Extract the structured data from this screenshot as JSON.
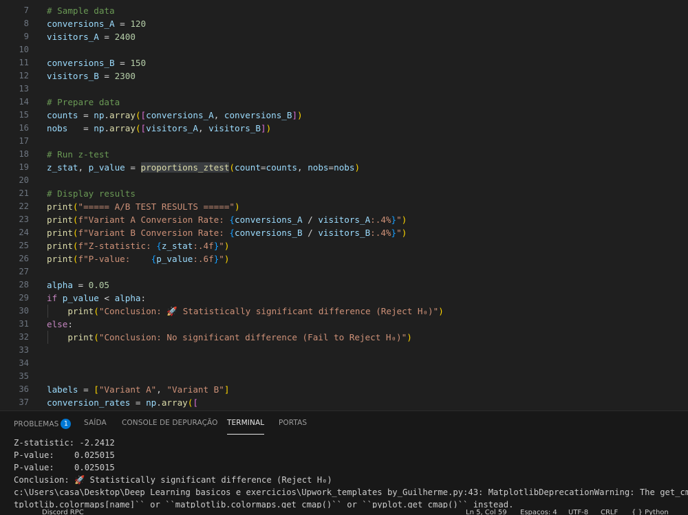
{
  "editor": {
    "lines": [
      {
        "n": "7",
        "tokens": [
          [
            "t-cm",
            "# Sample data"
          ]
        ]
      },
      {
        "n": "8",
        "tokens": [
          [
            "t-var",
            "conversions_A"
          ],
          [
            "t-op",
            " = "
          ],
          [
            "t-num",
            "120"
          ]
        ]
      },
      {
        "n": "9",
        "tokens": [
          [
            "t-var",
            "visitors_A"
          ],
          [
            "t-op",
            " = "
          ],
          [
            "t-num",
            "2400"
          ]
        ]
      },
      {
        "n": "10",
        "tokens": []
      },
      {
        "n": "11",
        "tokens": [
          [
            "t-var",
            "conversions_B"
          ],
          [
            "t-op",
            " = "
          ],
          [
            "t-num",
            "150"
          ]
        ]
      },
      {
        "n": "12",
        "tokens": [
          [
            "t-var",
            "visitors_B"
          ],
          [
            "t-op",
            " = "
          ],
          [
            "t-num",
            "2300"
          ]
        ]
      },
      {
        "n": "13",
        "tokens": []
      },
      {
        "n": "14",
        "tokens": [
          [
            "t-cm",
            "# Prepare data"
          ]
        ]
      },
      {
        "n": "15",
        "tokens": [
          [
            "t-var",
            "counts"
          ],
          [
            "t-op",
            " = "
          ],
          [
            "t-var",
            "np"
          ],
          [
            "t-op",
            "."
          ],
          [
            "t-fn",
            "array"
          ],
          [
            "t-b1",
            "("
          ],
          [
            "t-b2",
            "["
          ],
          [
            "t-var",
            "conversions_A"
          ],
          [
            "t-op",
            ", "
          ],
          [
            "t-var",
            "conversions_B"
          ],
          [
            "t-b2",
            "]"
          ],
          [
            "t-b1",
            ")"
          ]
        ]
      },
      {
        "n": "16",
        "tokens": [
          [
            "t-var",
            "nobs"
          ],
          [
            "t-op",
            "   = "
          ],
          [
            "t-var",
            "np"
          ],
          [
            "t-op",
            "."
          ],
          [
            "t-fn",
            "array"
          ],
          [
            "t-b1",
            "("
          ],
          [
            "t-b2",
            "["
          ],
          [
            "t-var",
            "visitors_A"
          ],
          [
            "t-op",
            ", "
          ],
          [
            "t-var",
            "visitors_B"
          ],
          [
            "t-b2",
            "]"
          ],
          [
            "t-b1",
            ")"
          ]
        ]
      },
      {
        "n": "17",
        "tokens": []
      },
      {
        "n": "18",
        "tokens": [
          [
            "t-cm",
            "# Run z-test"
          ]
        ]
      },
      {
        "n": "19",
        "tokens": [
          [
            "t-var",
            "z_stat"
          ],
          [
            "t-op",
            ", "
          ],
          [
            "t-var",
            "p_value"
          ],
          [
            "t-op",
            " = "
          ],
          [
            "t-fn t-hl",
            "proportions_ztest"
          ],
          [
            "t-b1",
            "("
          ],
          [
            "t-var",
            "count"
          ],
          [
            "t-op",
            "="
          ],
          [
            "t-var",
            "counts"
          ],
          [
            "t-op",
            ", "
          ],
          [
            "t-var",
            "nobs"
          ],
          [
            "t-op",
            "="
          ],
          [
            "t-var",
            "nobs"
          ],
          [
            "t-b1",
            ")"
          ]
        ]
      },
      {
        "n": "20",
        "tokens": []
      },
      {
        "n": "21",
        "tokens": [
          [
            "t-cm",
            "# Display results"
          ]
        ]
      },
      {
        "n": "22",
        "tokens": [
          [
            "t-fn",
            "print"
          ],
          [
            "t-b1",
            "("
          ],
          [
            "t-str",
            "\"===== A/B TEST RESULTS =====\""
          ],
          [
            "t-b1",
            ")"
          ]
        ]
      },
      {
        "n": "23",
        "tokens": [
          [
            "t-fn",
            "print"
          ],
          [
            "t-b1",
            "("
          ],
          [
            "t-str",
            "f\"Variant A Conversion Rate: "
          ],
          [
            "t-b3",
            "{"
          ],
          [
            "t-var",
            "conversions_A"
          ],
          [
            "t-op",
            " / "
          ],
          [
            "t-var",
            "visitors_A"
          ],
          [
            "t-str",
            ":.4%"
          ],
          [
            "t-b3",
            "}"
          ],
          [
            "t-str",
            "\""
          ],
          [
            "t-b1",
            ")"
          ]
        ]
      },
      {
        "n": "24",
        "tokens": [
          [
            "t-fn",
            "print"
          ],
          [
            "t-b1",
            "("
          ],
          [
            "t-str",
            "f\"Variant B Conversion Rate: "
          ],
          [
            "t-b3",
            "{"
          ],
          [
            "t-var",
            "conversions_B"
          ],
          [
            "t-op",
            " / "
          ],
          [
            "t-var",
            "visitors_B"
          ],
          [
            "t-str",
            ":.4%"
          ],
          [
            "t-b3",
            "}"
          ],
          [
            "t-str",
            "\""
          ],
          [
            "t-b1",
            ")"
          ]
        ]
      },
      {
        "n": "25",
        "tokens": [
          [
            "t-fn",
            "print"
          ],
          [
            "t-b1",
            "("
          ],
          [
            "t-str",
            "f\"Z-statistic: "
          ],
          [
            "t-b3",
            "{"
          ],
          [
            "t-var",
            "z_stat"
          ],
          [
            "t-str",
            ":.4f"
          ],
          [
            "t-b3",
            "}"
          ],
          [
            "t-str",
            "\""
          ],
          [
            "t-b1",
            ")"
          ]
        ]
      },
      {
        "n": "26",
        "tokens": [
          [
            "t-fn",
            "print"
          ],
          [
            "t-b1",
            "("
          ],
          [
            "t-str",
            "f\"P-value:    "
          ],
          [
            "t-b3",
            "{"
          ],
          [
            "t-var",
            "p_value"
          ],
          [
            "t-str",
            ":.6f"
          ],
          [
            "t-b3",
            "}"
          ],
          [
            "t-str",
            "\""
          ],
          [
            "t-b1",
            ")"
          ]
        ]
      },
      {
        "n": "27",
        "tokens": []
      },
      {
        "n": "28",
        "tokens": [
          [
            "t-var",
            "alpha"
          ],
          [
            "t-op",
            " = "
          ],
          [
            "t-num",
            "0.05"
          ]
        ]
      },
      {
        "n": "29",
        "tokens": [
          [
            "t-kw",
            "if"
          ],
          [
            "t-op",
            " "
          ],
          [
            "t-var",
            "p_value"
          ],
          [
            "t-op",
            " < "
          ],
          [
            "t-var",
            "alpha"
          ],
          [
            "t-op",
            ":"
          ]
        ]
      },
      {
        "n": "30",
        "guide": true,
        "tokens": [
          [
            "t-op",
            "    "
          ],
          [
            "t-fn",
            "print"
          ],
          [
            "t-b1",
            "("
          ],
          [
            "t-str",
            "\"Conclusion: 🚀 Statistically significant difference (Reject H₀)\""
          ],
          [
            "t-b1",
            ")"
          ]
        ]
      },
      {
        "n": "31",
        "tokens": [
          [
            "t-kw",
            "else"
          ],
          [
            "t-op",
            ":"
          ]
        ]
      },
      {
        "n": "32",
        "guide": true,
        "tokens": [
          [
            "t-op",
            "    "
          ],
          [
            "t-fn",
            "print"
          ],
          [
            "t-b1",
            "("
          ],
          [
            "t-str",
            "\"Conclusion: No significant difference (Fail to Reject H₀)\""
          ],
          [
            "t-b1",
            ")"
          ]
        ]
      },
      {
        "n": "33",
        "tokens": []
      },
      {
        "n": "34",
        "tokens": []
      },
      {
        "n": "35",
        "tokens": []
      },
      {
        "n": "36",
        "tokens": [
          [
            "t-var",
            "labels"
          ],
          [
            "t-op",
            " = "
          ],
          [
            "t-b1",
            "["
          ],
          [
            "t-str",
            "\"Variant A\""
          ],
          [
            "t-op",
            ", "
          ],
          [
            "t-str",
            "\"Variant B\""
          ],
          [
            "t-b1",
            "]"
          ]
        ]
      },
      {
        "n": "37",
        "tokens": [
          [
            "t-var",
            "conversion_rates"
          ],
          [
            "t-op",
            " = "
          ],
          [
            "t-var",
            "np"
          ],
          [
            "t-op",
            "."
          ],
          [
            "t-fn",
            "array"
          ],
          [
            "t-b1",
            "("
          ],
          [
            "t-b2",
            "["
          ]
        ]
      }
    ]
  },
  "panel": {
    "tabs": [
      {
        "label": "PROBLEMAS",
        "badge": "1",
        "name": "tab-problemas"
      },
      {
        "label": "SAÍDA",
        "name": "tab-saida"
      },
      {
        "label": "CONSOLE DE DEPURAÇÃO",
        "name": "tab-console-depuracao"
      },
      {
        "label": "TERMINAL",
        "name": "tab-terminal",
        "active": true
      },
      {
        "label": "PORTAS",
        "name": "tab-portas"
      }
    ],
    "terminal_lines": [
      "Z-statistic: -2.2412",
      "P-value:    0.025015",
      "P-value:    0.025015",
      "Conclusion: 🚀 Statistically significant difference (Reject H₀)",
      "c:\\Users\\casa\\Desktop\\Deep Learning basicos e exercicios\\Upwork_templates by_Guilherme.py:43: MatplotlibDeprecationWarning: The get_cmap fun",
      "tplotlib.colormaps[name]`` or ``matplotlib.colormaps.get_cmap()`` or ``pyplot.get_cmap()`` instead."
    ]
  },
  "statusbar": {
    "errors": "0",
    "warnings": "1",
    "discord": "Discord RPC",
    "position": "Ln 5, Col 59",
    "spaces": "Espaços: 4",
    "encoding": "UTF-8",
    "eol": "CRLF",
    "language": "Python"
  }
}
